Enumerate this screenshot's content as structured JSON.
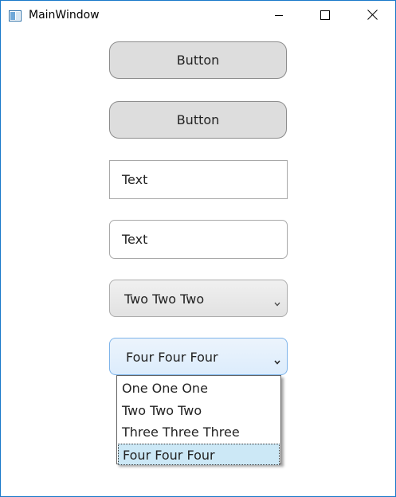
{
  "window": {
    "title": "MainWindow"
  },
  "controls": {
    "button1_label": "Button",
    "button2_label": "Button",
    "textbox1_value": "Text",
    "textbox2_value": "Text",
    "combo1_value": "Two Two Two",
    "combo2_value": "Four Four Four"
  },
  "dropdown": {
    "items": [
      "One One One",
      "Two Two Two",
      "Three Three Three",
      "Four Four Four"
    ],
    "selected_index": 3
  },
  "colors": {
    "window_border": "#1979ca",
    "combo_open_border": "#7eb4ea",
    "selected_item_bg": "#cce8f6"
  }
}
